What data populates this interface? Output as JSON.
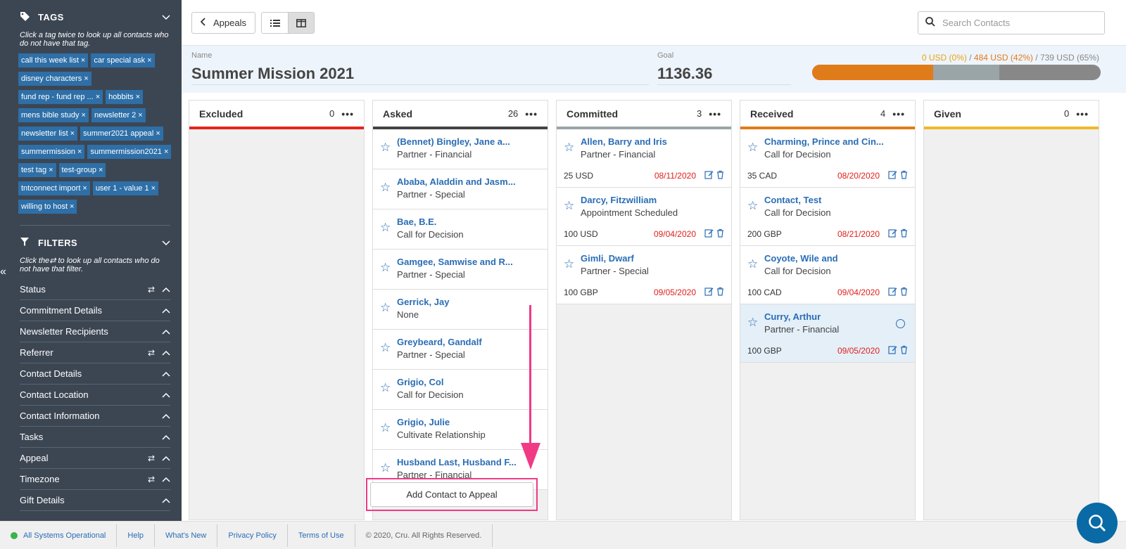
{
  "sidebar": {
    "tags_title": "TAGS",
    "tags_hint": "Click a tag twice to look up all contacts who do not have that tag.",
    "tags": [
      "call this week list",
      "car special ask",
      "disney characters",
      "fund rep - fund rep ...",
      "hobbits",
      "mens bible study",
      "newsletter 2",
      "newsletter list",
      "summer2021 appeal",
      "summermission",
      "summermission2021",
      "test tag",
      "test-group",
      "tntconnect import",
      "user 1 - value 1",
      "willing to host"
    ],
    "filters_title": "FILTERS",
    "filters_hint_pre": "Click the",
    "filters_hint_post": "to look up all contacts who do not have that filter.",
    "filters": [
      {
        "label": "Status",
        "swap": true
      },
      {
        "label": "Commitment Details",
        "swap": false
      },
      {
        "label": "Newsletter Recipients",
        "swap": false
      },
      {
        "label": "Referrer",
        "swap": true
      },
      {
        "label": "Contact Details",
        "swap": false
      },
      {
        "label": "Contact Location",
        "swap": false
      },
      {
        "label": "Contact Information",
        "swap": false
      },
      {
        "label": "Tasks",
        "swap": false
      },
      {
        "label": "Appeal",
        "swap": true
      },
      {
        "label": "Timezone",
        "swap": true
      },
      {
        "label": "Gift Details",
        "swap": false
      }
    ]
  },
  "topbar": {
    "back_label": "Appeals",
    "search_placeholder": "Search Contacts"
  },
  "appeal": {
    "name_label": "Name",
    "name": "Summer Mission 2021",
    "goal_label": "Goal",
    "goal": "1136.36",
    "progress_given": "0 USD (0%)",
    "progress_received": "484 USD (42%)",
    "progress_committed": "739 USD (65%)",
    "progress_pct": {
      "given": 0,
      "received": 42,
      "committed": 65
    },
    "colors": {
      "received": "#e07b1a",
      "committed": "#9aa5a8",
      "remaining": "#888888"
    }
  },
  "columns": [
    {
      "title": "Excluded",
      "count": "0",
      "color": "#e8231c",
      "cards": []
    },
    {
      "title": "Asked",
      "count": "26",
      "color": "#444444",
      "cards": [
        {
          "name": "(Bennet) Bingley, Jane a...",
          "status": "Partner - Financial"
        },
        {
          "name": "Ababa, Aladdin and Jasm...",
          "status": "Partner - Special"
        },
        {
          "name": "Bae, B.E.",
          "status": "Call for Decision"
        },
        {
          "name": "Gamgee, Samwise and R...",
          "status": "Partner - Special"
        },
        {
          "name": "Gerrick, Jay",
          "status": "None"
        },
        {
          "name": "Greybeard, Gandalf",
          "status": "Partner - Special"
        },
        {
          "name": "Grigio, Col",
          "status": "Call for Decision"
        },
        {
          "name": "Grigio, Julie",
          "status": "Cultivate Relationship"
        },
        {
          "name": "Husband Last, Husband F...",
          "status": "Partner - Financial"
        }
      ]
    },
    {
      "title": "Committed",
      "count": "3",
      "color": "#9aa5a8",
      "cards": [
        {
          "name": "Allen, Barry and Iris",
          "status": "Partner - Financial",
          "amount": "25 USD",
          "date": "08/11/2020"
        },
        {
          "name": "Darcy, Fitzwilliam",
          "status": "Appointment Scheduled",
          "amount": "100 USD",
          "date": "09/04/2020"
        },
        {
          "name": "Gimli, Dwarf",
          "status": "Partner - Special",
          "amount": "100 GBP",
          "date": "09/05/2020"
        }
      ]
    },
    {
      "title": "Received",
      "count": "4",
      "color": "#e07b1a",
      "cards": [
        {
          "name": "Charming, Prince and Cin...",
          "status": "Call for Decision",
          "amount": "35 CAD",
          "date": "08/20/2020"
        },
        {
          "name": "Contact, Test",
          "status": "Call for Decision",
          "amount": "200 GBP",
          "date": "08/21/2020"
        },
        {
          "name": "Coyote, Wile and",
          "status": "Call for Decision",
          "amount": "100 CAD",
          "date": "09/04/2020"
        },
        {
          "name": "Curry, Arthur",
          "status": "Partner - Financial",
          "amount": "100 GBP",
          "date": "09/05/2020",
          "highlight": true
        }
      ]
    },
    {
      "title": "Given",
      "count": "0",
      "color": "#f0b92a",
      "cards": []
    }
  ],
  "add_contact_label": "Add Contact to Appeal",
  "footer": {
    "status": "All Systems Operational",
    "links": [
      "Help",
      "What's New",
      "Privacy Policy",
      "Terms of Use"
    ],
    "copyright": "© 2020, Cru. All Rights Reserved."
  }
}
